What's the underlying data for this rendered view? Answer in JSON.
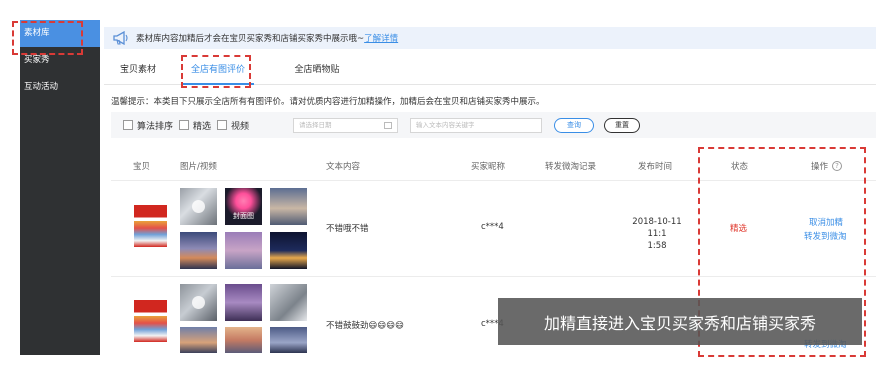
{
  "sidebar": {
    "items": [
      {
        "label": "素材库",
        "active": true
      },
      {
        "label": "买家秀",
        "active": false
      },
      {
        "label": "互动活动",
        "active": false
      }
    ]
  },
  "notice": {
    "icon": "megaphone-icon",
    "text": "素材库内容加精后才会在宝贝买家秀和店铺买家秀中展示哦~",
    "link": "了解详情"
  },
  "tabs": [
    {
      "label": "宝贝素材",
      "active": false
    },
    {
      "label": "全店有图评价",
      "active": true
    },
    {
      "label": "全店晒物贴",
      "active": false
    }
  ],
  "tip": "温馨提示：本类目下只展示全店所有有图评价。请对优质内容进行加精操作，加精后会在宝贝和店铺买家秀中展示。",
  "filters": {
    "checkboxes": [
      "算法排序",
      "精选",
      "视频"
    ],
    "date_placeholder": "请选择日期",
    "keyword_placeholder": "输入文本内容关键字",
    "query_button": "查询",
    "reset_button": "重置"
  },
  "table": {
    "headers": [
      "宝贝",
      "图片/视频",
      "文本内容",
      "买家昵称",
      "转发微淘记录",
      "发布时间",
      "状态",
      "操作"
    ],
    "rows": [
      {
        "text": "不错哦不错",
        "nickname": "c***4",
        "forward": "",
        "time_line1": "2018-10-11 11:1",
        "time_line2": "1:58",
        "status": "精选",
        "actions": [
          "取消加精",
          "转发到微淘"
        ],
        "cover_label": "封面图"
      },
      {
        "text": "不错鼓鼓劲😄😄😄😄",
        "nickname": "c***4",
        "actions": [
          "转发到微淘"
        ]
      }
    ]
  },
  "overlay_caption": "加精直接进入宝贝买家秀和店铺买家秀",
  "colors": {
    "sidebar_bg": "#2f3133",
    "sidebar_active": "#4a90e2",
    "accent": "#3a8ee6",
    "status_red": "#e03a2f",
    "highlight_dash": "#d93a36"
  }
}
